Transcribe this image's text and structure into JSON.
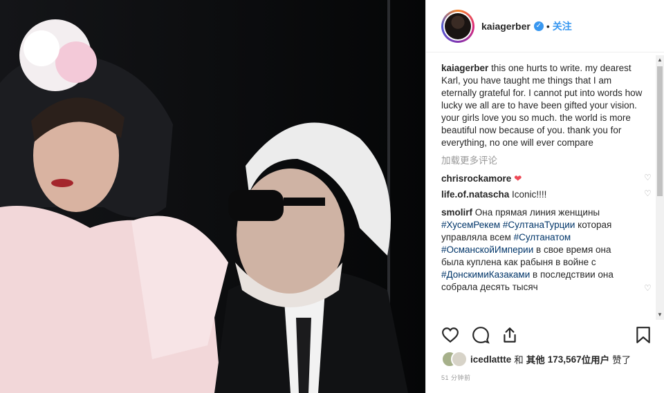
{
  "post": {
    "username": "kaiagerber",
    "follow_label": "关注",
    "caption_username": "kaiagerber",
    "caption_text": "this one hurts to write. my dearest Karl, you have taught me things that I am eternally grateful for. I cannot put into words how lucky we all are to have been gifted your vision. your girls love you so much. the world is more beautiful now because of you. thank you for everything, no one will ever compare",
    "load_more": "加载更多评论",
    "comments": [
      {
        "user": "chrisrockamore",
        "text": "",
        "emoji": "❤"
      },
      {
        "user": "life.of.natascha",
        "text": "Iconic!!!!"
      }
    ],
    "long_comment": {
      "user": "smolirf",
      "p1": "Она прямая линия женщины",
      "tag1": "#ХусемРекем",
      "tag2": "#СултанаТурции",
      "p2": "которая управляла всем",
      "tag3": "#Султанатом",
      "tag4": "#ОсманскойИмперии",
      "p3": "в свое время она была куплена как рабыня в войне с",
      "tag5": "#ДонскимиКазаками",
      "p4": "в последствии она собрала десять тысяч"
    },
    "likes": {
      "user": "icedlattte",
      "and": "和",
      "others_prefix": "其他",
      "count": "173,567",
      "others_suffix": "位用户",
      "liked": "赞了"
    },
    "time": "51 分钟前"
  },
  "icons": [
    "verified-icon",
    "like-icon",
    "comment-icon",
    "share-icon",
    "save-icon",
    "comment-like-icon"
  ],
  "colors": {
    "accent": "#3897f0",
    "text": "#262626",
    "muted": "#999999",
    "heart": "#ed4956",
    "hashtag": "#003569"
  }
}
